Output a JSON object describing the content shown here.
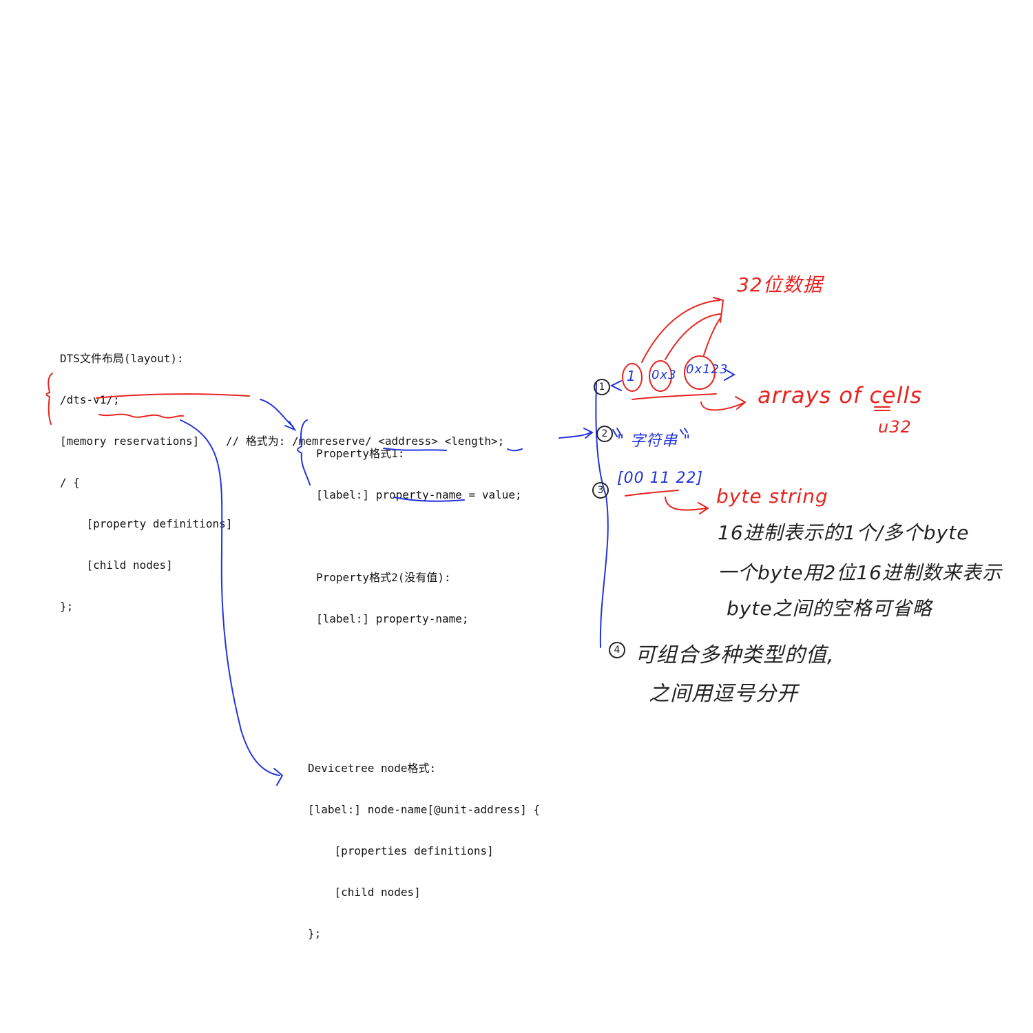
{
  "layout_block": {
    "lines": [
      "DTS文件布局(layout):",
      "/dts-v1/;",
      "[memory reservations]    // 格式为: /memreserve/ <address> <length>;",
      "/ {",
      "    [property definitions]",
      "    [child nodes]",
      "};"
    ]
  },
  "property_block": {
    "lines": [
      "Property格式1:",
      "[label:] property-name = value;",
      "",
      "Property格式2(没有值):",
      "[label:] property-name;"
    ]
  },
  "node_block": {
    "lines": [
      "Devicetree node格式:",
      "[label:] node-name[@unit-address] {",
      "    [properties definitions]",
      "    [child nodes]",
      "};"
    ]
  },
  "annotations": {
    "bits32": "32位数据",
    "cells_open": "<",
    "cell_1": "1",
    "cell_2": "0x3",
    "cell_3": "0x123",
    "cells_close": ">",
    "arrays_of_cells": "arrays of cells",
    "u32": "u32",
    "string_value": "\" 字符串 \"",
    "bytes_value": "[00 11 22]",
    "byte_string": "byte string",
    "byte_note_1": "16进制表示的1个/多个byte",
    "byte_note_2": "一个byte用2位16进制数来表示",
    "byte_note_3": "byte之间的空格可省略",
    "combo_note_1": "可组合多种类型的值,",
    "combo_note_2": "之间用逗号分开",
    "num_1": "1",
    "num_2": "2",
    "num_3": "3",
    "num_4": "4"
  },
  "colors": {
    "red": "#e8231f",
    "blue": "#2233dd",
    "text": "#111111"
  }
}
